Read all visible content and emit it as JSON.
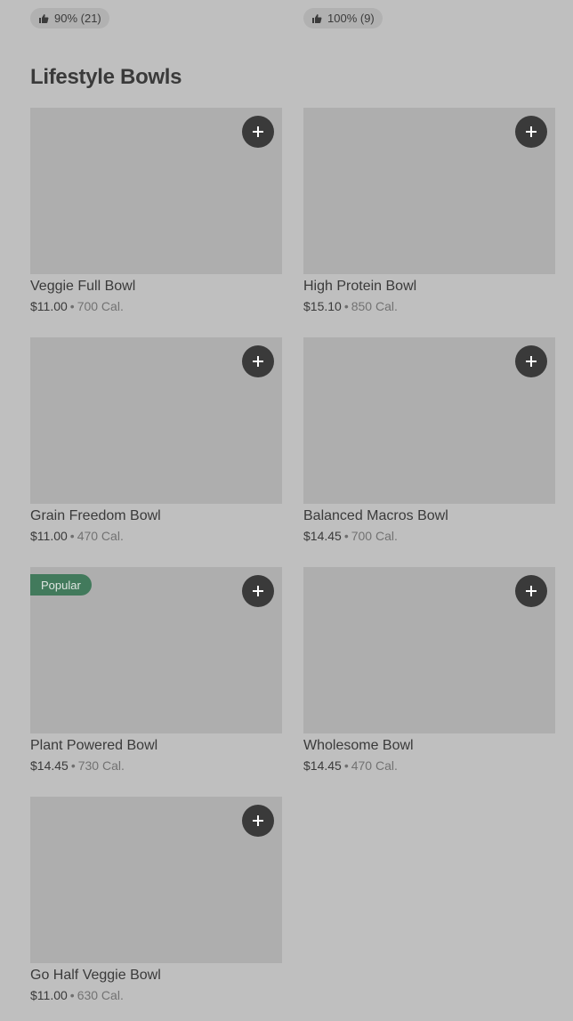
{
  "top_row": {
    "left_rating": "90% (21)",
    "right_rating": "100% (9)"
  },
  "section": {
    "title": "Lifestyle Bowls"
  },
  "items": [
    {
      "name": "Veggie Full Bowl",
      "price": "$11.00",
      "calories": "700 Cal.",
      "badge": ""
    },
    {
      "name": "High Protein Bowl",
      "price": "$15.10",
      "calories": "850 Cal.",
      "badge": ""
    },
    {
      "name": "Grain Freedom Bowl",
      "price": "$11.00",
      "calories": "470 Cal.",
      "badge": ""
    },
    {
      "name": "Balanced Macros Bowl",
      "price": "$14.45",
      "calories": "700 Cal.",
      "badge": ""
    },
    {
      "name": "Plant Powered Bowl",
      "price": "$14.45",
      "calories": "730 Cal.",
      "badge": "Popular"
    },
    {
      "name": "Wholesome Bowl",
      "price": "$14.45",
      "calories": "470 Cal.",
      "badge": ""
    },
    {
      "name": "Go Half Veggie Bowl",
      "price": "$11.00",
      "calories": "630 Cal.",
      "badge": ""
    }
  ],
  "separator": "•",
  "icons": {
    "add": "plus-icon",
    "rating": "thumbs-up-icon"
  },
  "colors": {
    "background": "#bfbfbf",
    "image_placeholder": "#aeaeae",
    "add_button": "#3a3a3a",
    "popular_badge": "#427a5c"
  }
}
